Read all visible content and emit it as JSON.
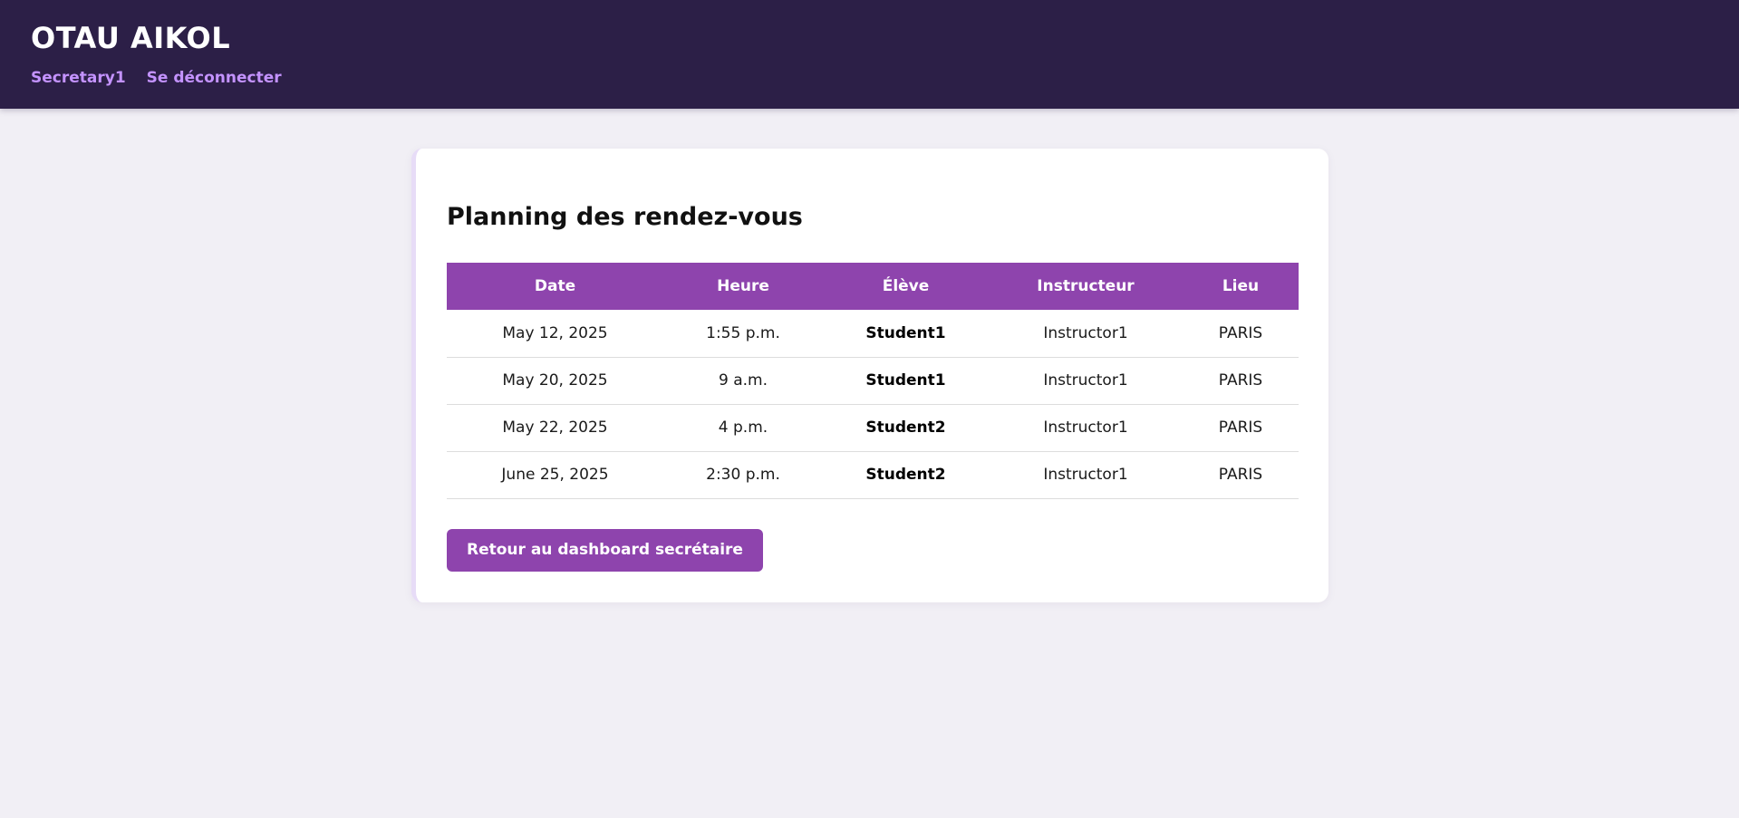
{
  "app": {
    "brand": "OTAU AIKOL",
    "user_link": "Secretary1",
    "logout_link": "Se déconnecter"
  },
  "page": {
    "title": "Planning des rendez-vous"
  },
  "table": {
    "headers": [
      "Date",
      "Heure",
      "Élève",
      "Instructeur",
      "Lieu"
    ],
    "rows": [
      {
        "date": "May 12, 2025",
        "time": "1:55 p.m.",
        "student": "Student1",
        "instructor": "Instructor1",
        "location": "PARIS"
      },
      {
        "date": "May 20, 2025",
        "time": "9 a.m.",
        "student": "Student1",
        "instructor": "Instructor1",
        "location": "PARIS"
      },
      {
        "date": "May 22, 2025",
        "time": "4 p.m.",
        "student": "Student2",
        "instructor": "Instructor1",
        "location": "PARIS"
      },
      {
        "date": "June 25, 2025",
        "time": "2:30 p.m.",
        "student": "Student2",
        "instructor": "Instructor1",
        "location": "PARIS"
      }
    ]
  },
  "actions": {
    "back_label": "Retour au dashboard secrétaire"
  },
  "colors": {
    "navbar": "#2c1f47",
    "accent": "#8e44ad",
    "nav_link": "#c493ff",
    "background": "#f1eff5"
  }
}
